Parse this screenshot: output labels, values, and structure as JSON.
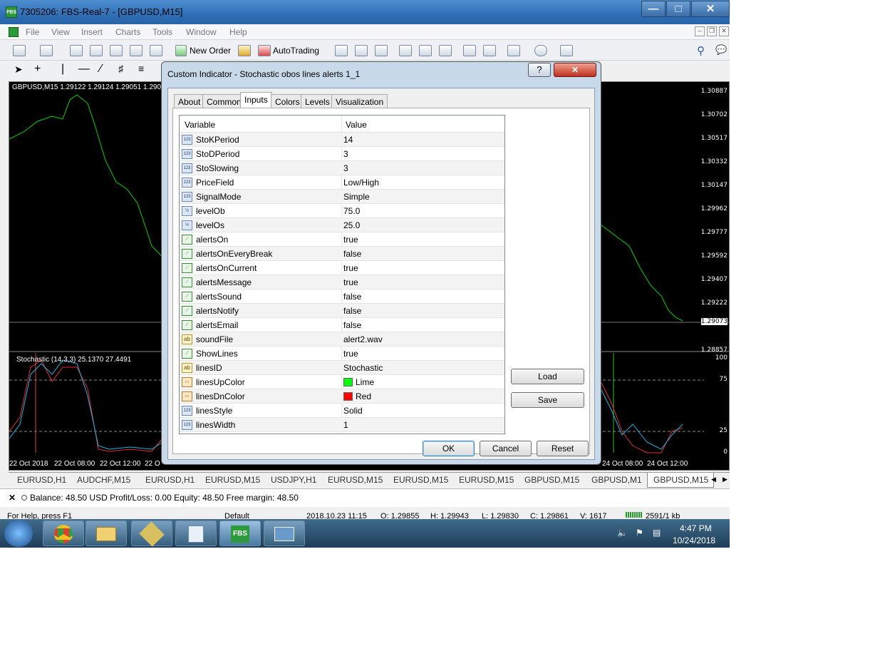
{
  "window": {
    "title": "7305206: FBS-Real-7 - [GBPUSD,M15]",
    "app_icon": "FBS"
  },
  "menu": [
    "File",
    "View",
    "Insert",
    "Charts",
    "Tools",
    "Window",
    "Help"
  ],
  "toolbar": {
    "new_order": "New Order",
    "autotrading": "AutoTrading"
  },
  "chart": {
    "header": "GBPUSD,M15  1.29122 1.29124 1.29051 1.290",
    "price_ticks": [
      "1.30887",
      "1.30702",
      "1.30517",
      "1.30332",
      "1.30147",
      "1.29962",
      "1.29777",
      "1.29592",
      "1.29407",
      "1.29222",
      "1.29073",
      "1.28857"
    ],
    "sub_label": "Stochastic  (14,3,3) 25.1370 27.4491",
    "sub_ticks": [
      "100",
      "75",
      "25",
      "0"
    ],
    "time_ticks": [
      "22 Oct 2018",
      "22 Oct 08:00",
      "22 Oct 12:00",
      "22 O",
      "24 Oct 08:00",
      "24 Oct 12:00"
    ]
  },
  "chart_tabs": [
    "EURUSD,H1",
    "AUDCHF,M15",
    "EURUSD,H1",
    "EURUSD,M15",
    "USDJPY,H1",
    "EURUSD,M15",
    "EURUSD,M15",
    "EURUSD,M15",
    "GBPUSD,M15",
    "GBPUSD,M1",
    "GBPUSD,M15"
  ],
  "status": {
    "balance": "Balance: 48.50 USD  Profit/Loss: 0.00  Equity: 48.50  Free margin: 48.50",
    "help": "For Help, press F1",
    "profile": "Default",
    "datetime": "2018.10.23 11:15",
    "open": "O: 1.29855",
    "high": "H: 1.29943",
    "low": "L: 1.29830",
    "close": "C: 1.29861",
    "volume": "V: 1617",
    "traffic": "2591/1 kb"
  },
  "clock": {
    "time": "4:47 PM",
    "date": "10/24/2018"
  },
  "taskbar": {
    "fbs": "FBS"
  },
  "dialog": {
    "title": "Custom Indicator - Stochastic obos lines alerts 1_1",
    "help_btn": "?",
    "close_btn": "✕",
    "tabs": [
      "About",
      "Common",
      "Inputs",
      "Colors",
      "Levels",
      "Visualization"
    ],
    "col_variable": "Variable",
    "col_value": "Value",
    "rows": [
      {
        "type": "123",
        "name": "StoKPeriod",
        "value": "14"
      },
      {
        "type": "123",
        "name": "StoDPeriod",
        "value": "3"
      },
      {
        "type": "123",
        "name": "StoSlowing",
        "value": "3"
      },
      {
        "type": "123",
        "name": "PriceField",
        "value": "Low/High"
      },
      {
        "type": "123",
        "name": "SignalMode",
        "value": "Simple"
      },
      {
        "type": "½",
        "name": "levelOb",
        "value": "75.0"
      },
      {
        "type": "½",
        "name": "levelOs",
        "value": "25.0"
      },
      {
        "type": "alert",
        "name": "alertsOn",
        "value": "true"
      },
      {
        "type": "alert",
        "name": "alertsOnEveryBreak",
        "value": "false"
      },
      {
        "type": "alert",
        "name": "alertsOnCurrent",
        "value": "true"
      },
      {
        "type": "alert",
        "name": "alertsMessage",
        "value": "true"
      },
      {
        "type": "alert",
        "name": "alertsSound",
        "value": "false"
      },
      {
        "type": "alert",
        "name": "alertsNotify",
        "value": "false"
      },
      {
        "type": "alert",
        "name": "alertsEmail",
        "value": "false"
      },
      {
        "type": "ab",
        "name": "soundFile",
        "value": "alert2.wav"
      },
      {
        "type": "alert",
        "name": "ShowLines",
        "value": "true"
      },
      {
        "type": "ab",
        "name": "linesID",
        "value": " Stochastic"
      },
      {
        "type": "color",
        "name": "linesUpColor",
        "value": "Lime",
        "swatch": "#00ff00"
      },
      {
        "type": "color",
        "name": "linesDnColor",
        "value": "Red",
        "swatch": "#ff0000"
      },
      {
        "type": "123",
        "name": "linesStyle",
        "value": "Solid"
      },
      {
        "type": "123",
        "name": "linesWidth",
        "value": "1"
      }
    ],
    "load": "Load",
    "save": "Save",
    "ok": "OK",
    "cancel": "Cancel",
    "reset": "Reset"
  }
}
